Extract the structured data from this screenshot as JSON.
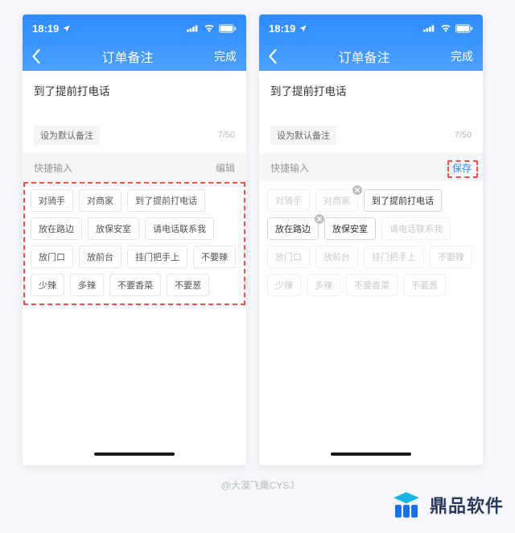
{
  "status": {
    "time": "18:19",
    "loc_icon": "location-arrow"
  },
  "nav": {
    "title": "订单备注",
    "done": "完成"
  },
  "note": {
    "text": "到了提前打电话",
    "default_btn": "设为默认备注",
    "count": "7/50"
  },
  "quick": {
    "label": "快捷输入",
    "edit": "编辑",
    "save": "保存"
  },
  "tags_left": [
    "对骑手",
    "对商家",
    "到了提前打电话",
    "放在路边",
    "放保安室",
    "请电话联系我",
    "放门口",
    "放前台",
    "挂门把手上",
    "不要辣",
    "少辣",
    "多辣",
    "不要香菜",
    "不要葱"
  ],
  "tags_right": [
    {
      "t": "对骑手",
      "s": "disabled"
    },
    {
      "t": "对商家",
      "s": "disabled",
      "close": true
    },
    {
      "t": "到了提前打电话",
      "s": "selected"
    },
    {
      "t": "放在路边",
      "s": "selected",
      "closeEdge": true
    },
    {
      "t": "放保安室",
      "s": "selected"
    },
    {
      "t": "请电话联系我",
      "s": "disabled"
    },
    {
      "t": "放门口",
      "s": "disabled"
    },
    {
      "t": "放前台",
      "s": "disabled"
    },
    {
      "t": "挂门把手上",
      "s": "disabled"
    },
    {
      "t": "不要辣",
      "s": "disabled"
    },
    {
      "t": "少辣",
      "s": "disabled"
    },
    {
      "t": "多辣",
      "s": "disabled"
    },
    {
      "t": "不要香菜",
      "s": "disabled"
    },
    {
      "t": "不要葱",
      "s": "disabled"
    }
  ],
  "credit": "@大漠飞鹰CYSJ",
  "brand": "鼎品软件"
}
